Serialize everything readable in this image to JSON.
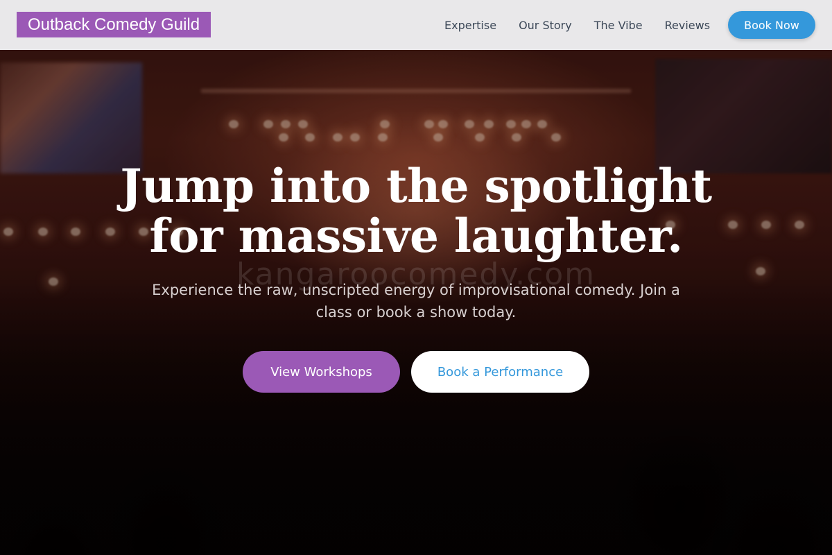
{
  "colors": {
    "brand_purple": "#9b59b6",
    "accent_blue": "#3498db",
    "nav_background": "#f0f0f2",
    "nav_text": "#3c4858"
  },
  "header": {
    "brand": "Outback Comedy Guild",
    "nav_links": [
      "Expertise",
      "Our Story",
      "The Vibe",
      "Reviews"
    ],
    "cta_label": "Book Now"
  },
  "hero": {
    "background_image": "concert-crowd-stage-lights",
    "title_line_1": "Jump into the spotlight",
    "title_line_2": "for massive laughter.",
    "subtitle": "Experience the raw, unscripted energy of improvisational comedy. Join a class or book a show today.",
    "watermark": "kangaroocomedy.com",
    "primary_button": "View Workshops",
    "secondary_button": "Book a Performance"
  }
}
